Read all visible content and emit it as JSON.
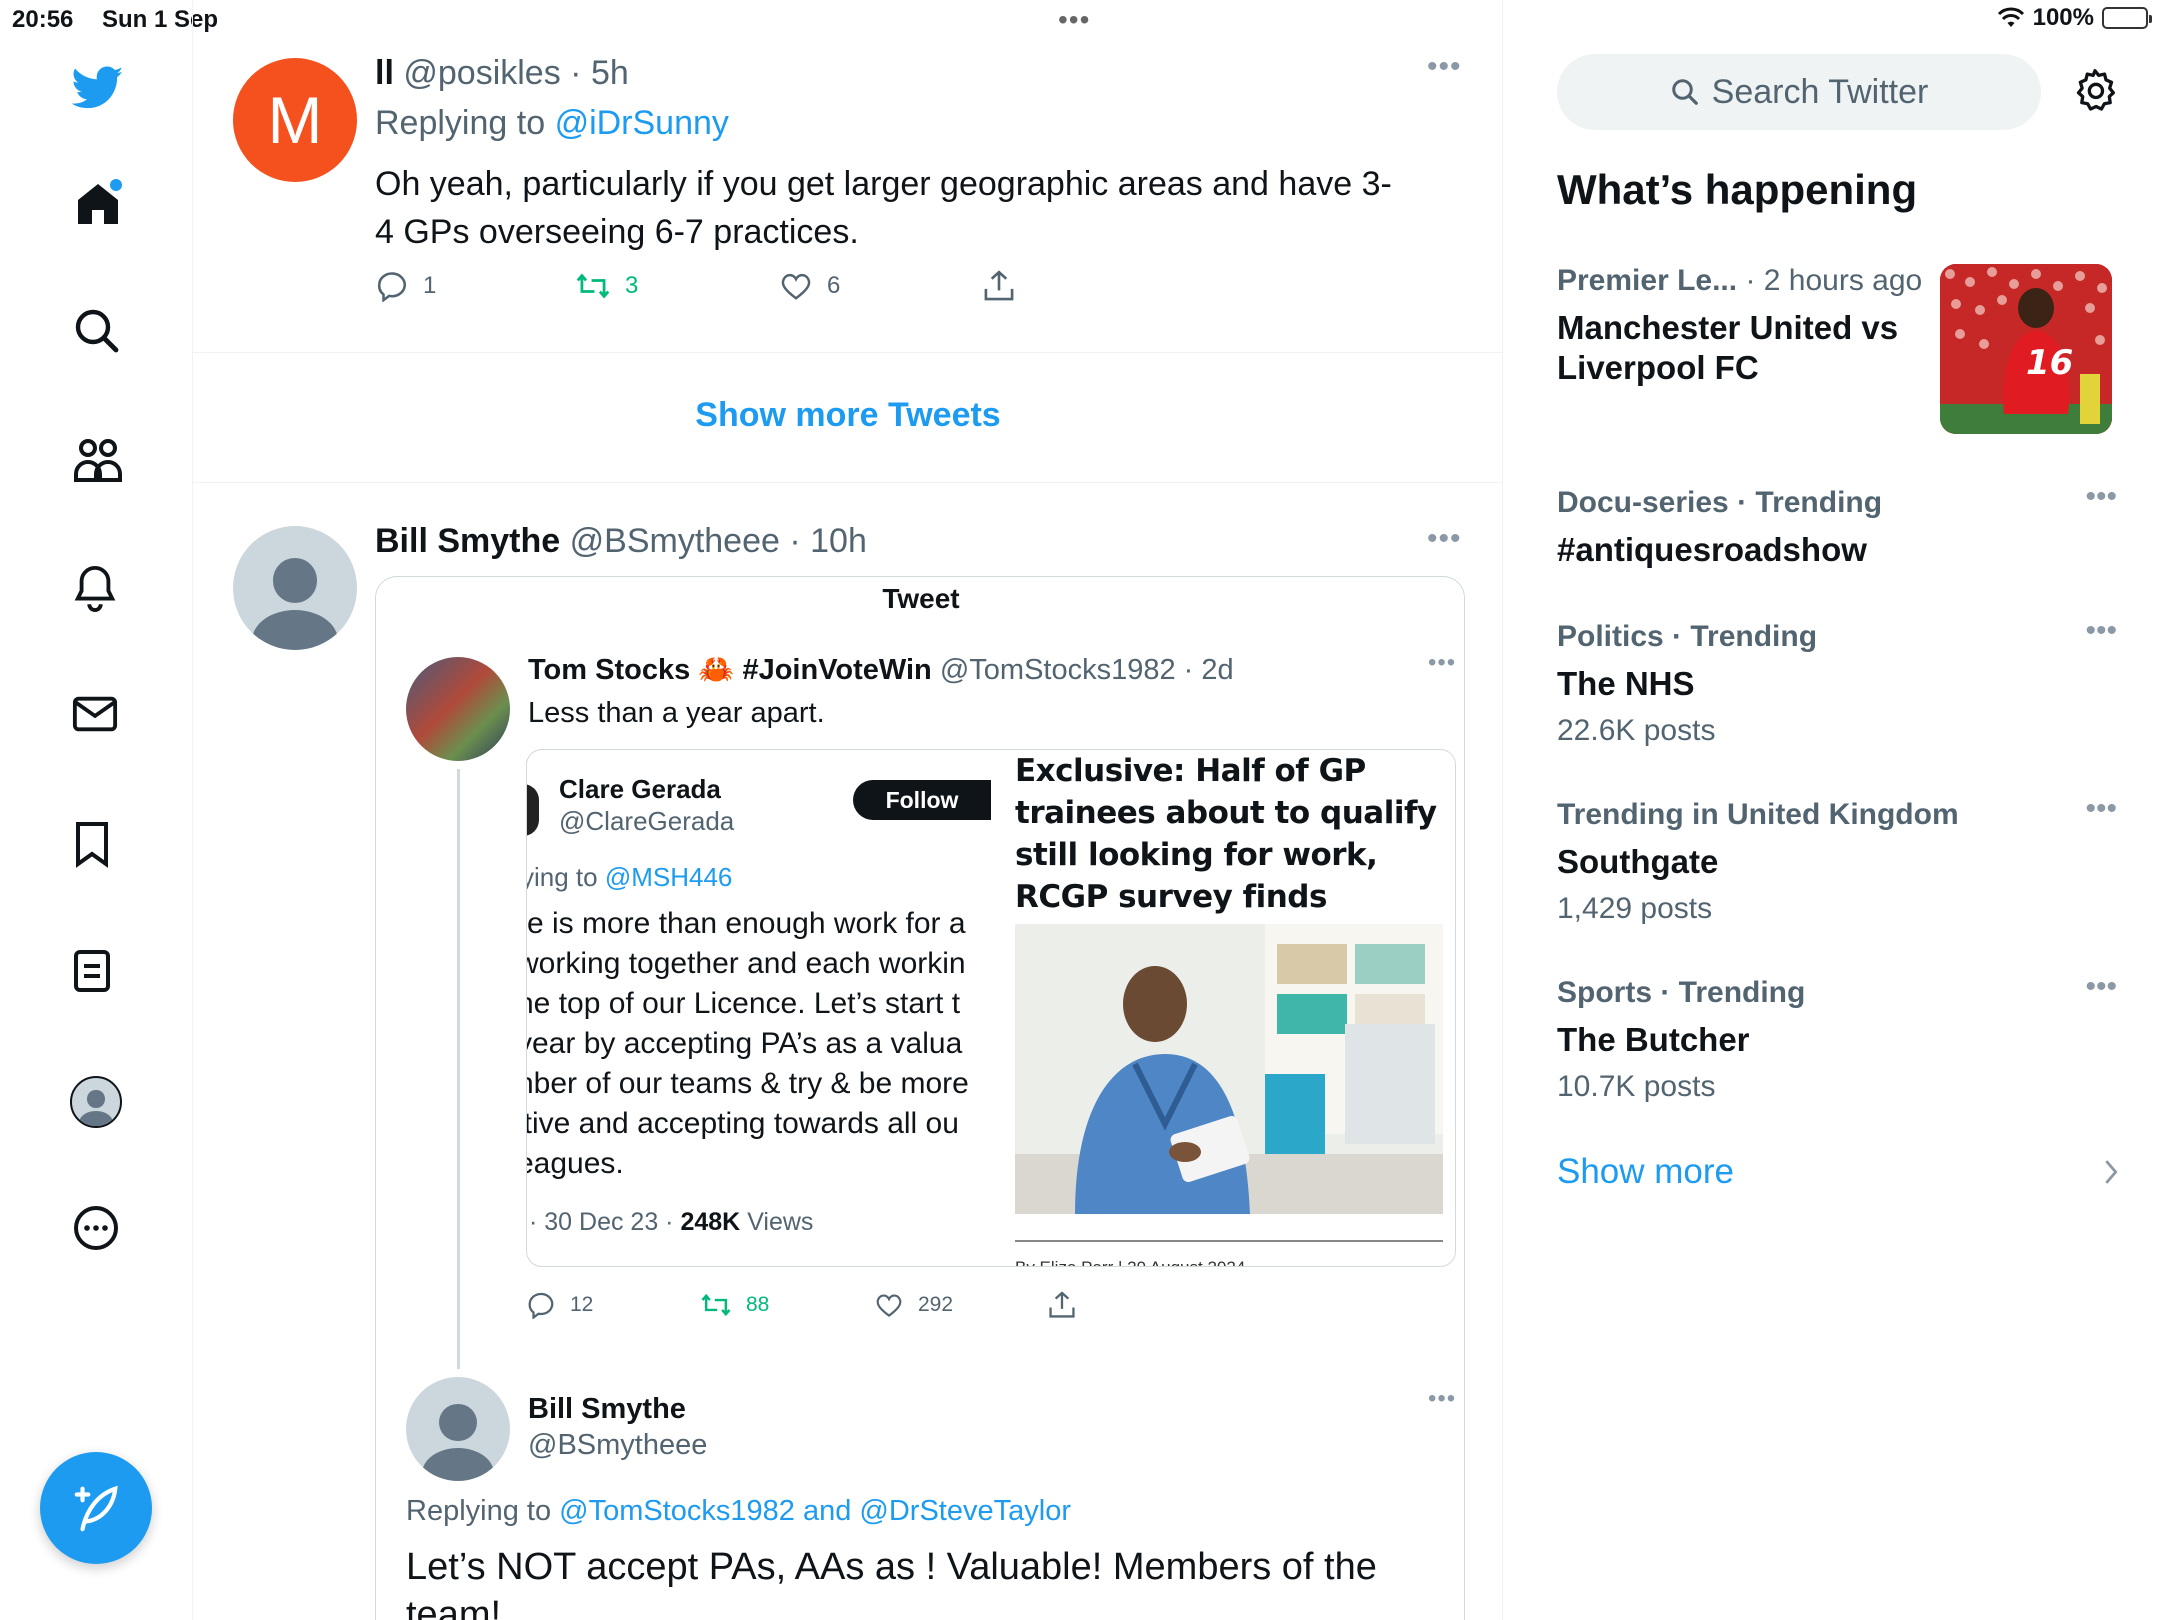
{
  "status_bar": {
    "time": "20:56",
    "date": "Sun 1 Sep",
    "battery": "100%",
    "battery_level": 1.0
  },
  "nav": {
    "icons": [
      "twitter-bird-icon",
      "home-icon",
      "search-icon",
      "communities-icon",
      "notifications-icon",
      "messages-icon",
      "bookmarks-icon",
      "lists-icon",
      "profile-icon",
      "more-icon"
    ],
    "compose_icon": "compose-feather-icon"
  },
  "tweet1": {
    "avatar_letter": "M",
    "name": "ll",
    "handle": "@posikles",
    "time": "5h",
    "replying_label": "Replying to",
    "replying_to": "@iDrSunny",
    "text": "Oh yeah, particularly if you get larger geographic areas and have 3-4 GPs overseeing 6-7 practices.",
    "replies": "1",
    "retweets": "3",
    "likes": "6"
  },
  "show_more_tweets": "Show more Tweets",
  "tweet2": {
    "name": "Bill Smythe",
    "handle": "@BSmytheee",
    "time": "10h",
    "quote": {
      "title": "Tweet",
      "author": {
        "name": "Tom Stocks",
        "emoji": "🦀",
        "hashtag": "#JoinVoteWin",
        "handle": "@TomStocks1982",
        "time": "2d"
      },
      "text": "Less than a year apart.",
      "embedded_left": {
        "name": "Clare Gerada",
        "handle": "@ClareGerada",
        "follow": "Follow",
        "replying_label": "ying to",
        "replying_to": "@MSH446",
        "lines": [
          "re is more than enough work for a",
          "working together and each workin",
          "he top of our Licence. Let’s start t",
          " year by accepting PA’s as a valua",
          "nber of our teams & try & be more",
          "itive and accepting towards all ou",
          "eagues."
        ],
        "meta_date": "· 30 Dec 23 ·",
        "views_count": "248K",
        "views_label": "Views"
      },
      "embedded_right": {
        "headline": "Exclusive: Half of GP trainees about to qualify still looking for work, RCGP survey finds",
        "byline": "By Eliza Parr | 29 August 2024"
      },
      "replies": "12",
      "retweets": "88",
      "likes": "292",
      "reply": {
        "name": "Bill Smythe",
        "handle": "@BSmytheee",
        "replying_label": "Replying to",
        "replying_to": "@TomStocks1982 and @DrSteveTaylor",
        "text": "Let’s NOT accept PAs, AAs as ! Valuable! Members of the team!"
      }
    }
  },
  "sidebar": {
    "search_placeholder": "Search Twitter",
    "whats_happening": "What’s happening",
    "trends": [
      {
        "category": "Premier Le...",
        "meta": "· 2 hours ago",
        "title": "Manchester United vs Liverpool FC",
        "count": ""
      },
      {
        "category": "Docu-series · Trending",
        "meta": "",
        "title": "#antiquesroadshow",
        "count": ""
      },
      {
        "category": "Politics · Trending",
        "meta": "",
        "title": "The NHS",
        "count": "22.6K posts"
      },
      {
        "category": "Trending in United Kingdom",
        "meta": "",
        "title": "Southgate",
        "count": "1,429 posts"
      },
      {
        "category": "Sports · Trending",
        "meta": "",
        "title": "The Butcher",
        "count": "10.7K posts"
      }
    ],
    "show_more": "Show more"
  },
  "colors": {
    "accent": "#1d9bf0",
    "retweet": "#00ba7c",
    "avatar_m": "#f4511e",
    "text": "#0f1419",
    "muted": "#536471"
  }
}
